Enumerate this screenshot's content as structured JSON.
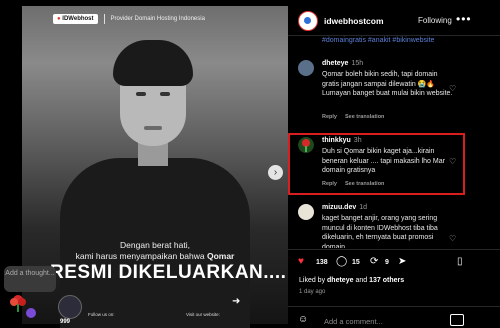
{
  "media": {
    "brand_logo": "IDWebhost",
    "brand_tagline": "Provider Domain Hosting Indonesia",
    "caption_line1": "Dengan berat hati,",
    "caption_line2_prefix": "kami harus menyampaikan bahwa",
    "caption_line2_bold": "Qomar",
    "headline": "RESMI DIKELUARKAN....",
    "follow_us": "Follow us on:",
    "visit_website": "Visit our website:",
    "footer_count": "999"
  },
  "overlay": {
    "thought_placeholder": "Add a thought..."
  },
  "post_header": {
    "username": "idwebhostcom",
    "follow_label": "Following",
    "more_icon": "more-dots-icon"
  },
  "hashtags": "#domaingratis #anakit #bikinwebsite",
  "comments": [
    {
      "user": "dheteye",
      "time": "15h",
      "text": "Qomar boleh bikin sedih, tapi domain gratis jangan sampai dilewatin 😭🔥 Lumayan banget buat mulai bikin website.",
      "reply": "Reply",
      "translate": "See translation"
    },
    {
      "user": "thinkkyu",
      "time": "3h",
      "text": "Duh si Qomar bikin kaget aja...kirain beneran keluar .... tapi makasih lho Mar domain gratisnya",
      "reply": "Reply",
      "translate": "See translation"
    },
    {
      "user": "mizuu.dev",
      "time": "1d",
      "text": "kaget banget anjir, orang yang sering muncul di konten IDWebhost tiba tiba dikeluarin, eh ternyata buat promosi domain"
    }
  ],
  "actions": {
    "likes": "138",
    "comments": "15",
    "reposts": "9"
  },
  "liked_by": {
    "prefix": "Liked by",
    "user": "dheteye",
    "conj": "and",
    "others": "137 others"
  },
  "time_ago": "1 day ago",
  "add_comment_placeholder": "Add a comment...",
  "colors": {
    "like_red": "#ff3040",
    "highlight_border": "#d81e1e",
    "hashtag_blue": "#5b7fd6"
  }
}
